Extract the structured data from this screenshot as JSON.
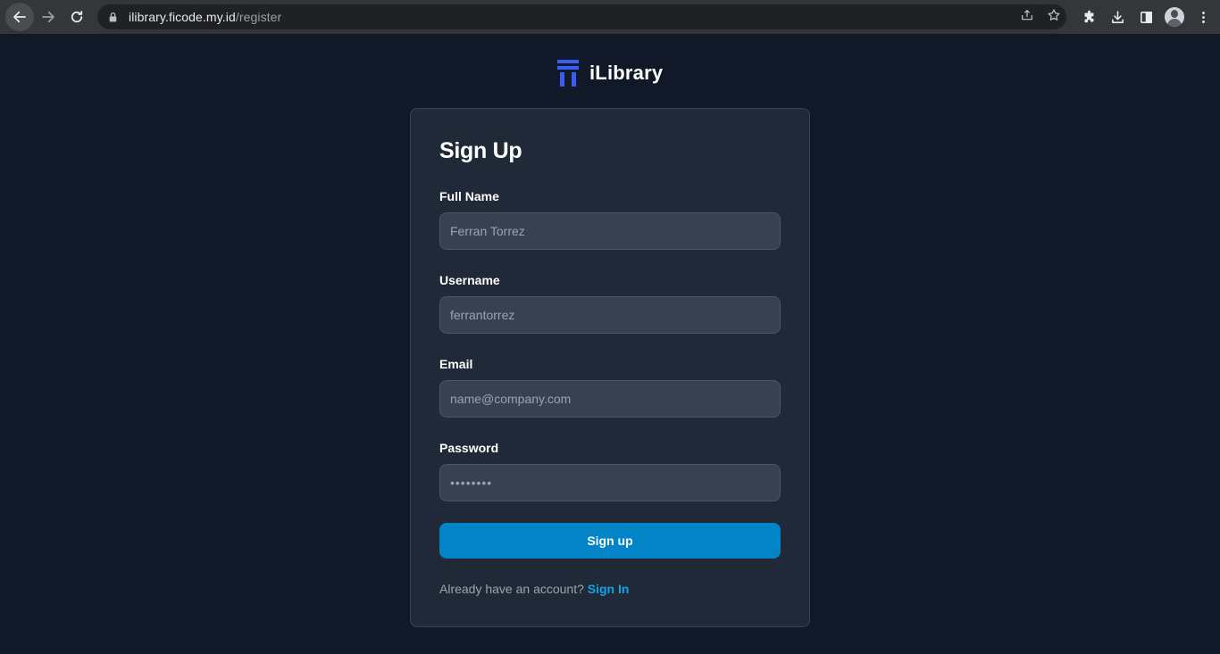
{
  "browser": {
    "url_host": "ilibrary.ficode.my.id",
    "url_path": "/register",
    "icons": [
      "back-arrow-icon",
      "forward-arrow-icon",
      "reload-icon",
      "lock-icon",
      "share-icon",
      "star-icon",
      "extensions-icon",
      "download-icon",
      "side-panel-icon",
      "profile-avatar",
      "more-menu-icon"
    ]
  },
  "brand": {
    "name": "iLibrary",
    "logo_color": "#3b5bf5"
  },
  "form": {
    "title": "Sign Up",
    "full_name": {
      "label": "Full Name",
      "placeholder": "Ferran Torrez"
    },
    "username": {
      "label": "Username",
      "placeholder": "ferrantorrez"
    },
    "email": {
      "label": "Email",
      "placeholder": "name@company.com"
    },
    "password": {
      "label": "Password",
      "placeholder": "••••••••"
    },
    "submit_label": "Sign up",
    "footer_prompt": "Already have an account?",
    "footer_link": "Sign In"
  },
  "colors": {
    "page_bg": "#111827",
    "card_bg": "#1f2937",
    "input_bg": "#374151",
    "button": "#0284c7",
    "link": "#0ea5e9"
  }
}
